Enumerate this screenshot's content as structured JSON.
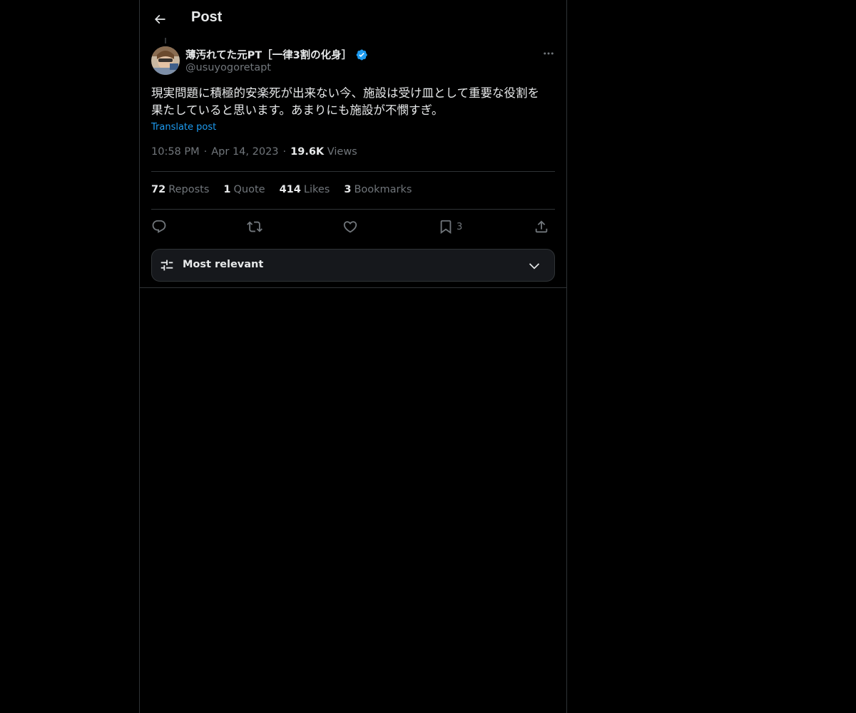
{
  "header": {
    "title": "Post"
  },
  "post": {
    "author": {
      "name": "薄汚れてた元PT［一律3割の化身］",
      "handle": "@usuyogoretapt",
      "verified": true
    },
    "text": "現実問題に積極的安楽死が出来ない今、施設は受け皿として重要な役割を\n果たしていると思います。あまりにも施設が不憫すぎ。",
    "translate_label": "Translate post",
    "time": "10:58 PM",
    "date": "Apr 14, 2023",
    "views_count": "19.6K",
    "views_label": "Views",
    "separator": "·"
  },
  "stats": {
    "reposts": {
      "count": "72",
      "label": "Reposts"
    },
    "quotes": {
      "count": "1",
      "label": "Quote"
    },
    "likes": {
      "count": "414",
      "label": "Likes"
    },
    "bookmarks": {
      "count": "3",
      "label": "Bookmarks"
    }
  },
  "actions": {
    "reply_icon": "reply-icon",
    "repost_icon": "repost-icon",
    "like_icon": "like-icon",
    "bookmark_icon": "bookmark-icon",
    "bookmark_count": "3",
    "share_icon": "share-icon"
  },
  "sort": {
    "label": "Most relevant"
  },
  "colors": {
    "background": "#000000",
    "text": "#e7e9ea",
    "muted": "#71767b",
    "accent": "#1d9bf0",
    "border": "#2f3336"
  }
}
